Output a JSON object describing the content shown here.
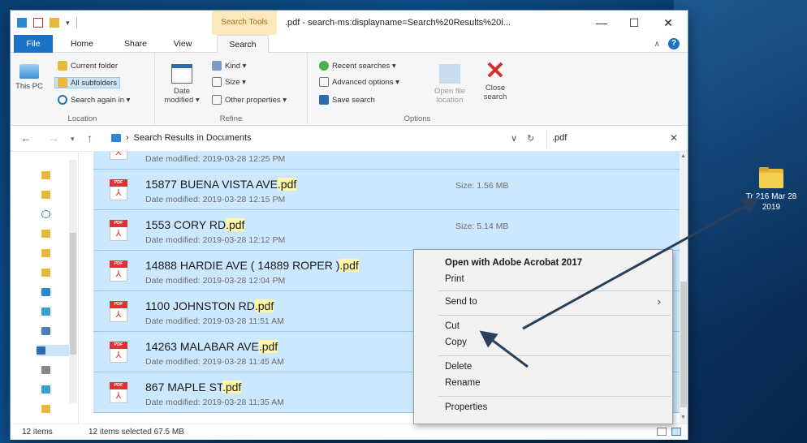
{
  "desktop": {
    "folder_label": "Tr 216 Mar 28 2019"
  },
  "titlebar": {
    "search_tools": "Search Tools",
    "title": ".pdf - search-ms:displayname=Search%20Results%20i...",
    "minimize": "—",
    "maximize": "☐",
    "close": "✕"
  },
  "ribbon_tabs": {
    "file": "File",
    "home": "Home",
    "share": "Share",
    "view": "View",
    "search": "Search"
  },
  "ribbon": {
    "location": {
      "this_pc": "This PC",
      "current_folder": "Current folder",
      "all_subfolders": "All subfolders",
      "search_again": "Search again in ▾",
      "group": "Location"
    },
    "refine": {
      "date_modified": "Date modified ▾",
      "kind": "Kind ▾",
      "size": "Size ▾",
      "other_properties": "Other properties ▾",
      "group": "Refine"
    },
    "options": {
      "recent_searches": "Recent searches ▾",
      "advanced_options": "Advanced options ▾",
      "save_search": "Save search",
      "open_file_location": "Open file location",
      "close_search": "Close search",
      "group": "Options"
    }
  },
  "address": {
    "breadcrumb": "Search Results in Documents",
    "search_value": ".pdf"
  },
  "files": [
    {
      "name": "",
      "ext": "",
      "modified": "Date modified: 2019-03-28 12:25 PM",
      "size": ""
    },
    {
      "name": "15877 BUENA VISTA AVE",
      "ext": ".pdf",
      "modified": "Date modified: 2019-03-28 12:15 PM",
      "size": "Size: 1.56 MB"
    },
    {
      "name": "1553 CORY RD",
      "ext": ".pdf",
      "modified": "Date modified: 2019-03-28 12:12 PM",
      "size": "Size: 5.14 MB"
    },
    {
      "name": "14888 HARDIE AVE ( 14889 ROPER )",
      "ext": ".pdf",
      "modified": "Date modified: 2019-03-28 12:04 PM",
      "size": ""
    },
    {
      "name": "1100 JOHNSTON RD",
      "ext": ".pdf",
      "modified": "Date modified: 2019-03-28 11:51 AM",
      "size": ""
    },
    {
      "name": "14263 MALABAR AVE",
      "ext": ".pdf",
      "modified": "Date modified: 2019-03-28 11:45 AM",
      "size": ""
    },
    {
      "name": "867 MAPLE ST",
      "ext": ".pdf",
      "modified": "Date modified: 2019-03-28 11:35 AM",
      "size": ""
    }
  ],
  "context_menu": {
    "open_with": "Open with Adobe Acrobat 2017",
    "print": "Print",
    "send_to": "Send to",
    "cut": "Cut",
    "copy": "Copy",
    "delete": "Delete",
    "rename": "Rename",
    "properties": "Properties"
  },
  "status": {
    "item_count": "12 items",
    "selected": "12 items selected  67.5 MB"
  },
  "colors": {
    "selection": "#cce8ff",
    "accent": "#1a73c7",
    "annotation_arrow": "#2a3f5c"
  }
}
